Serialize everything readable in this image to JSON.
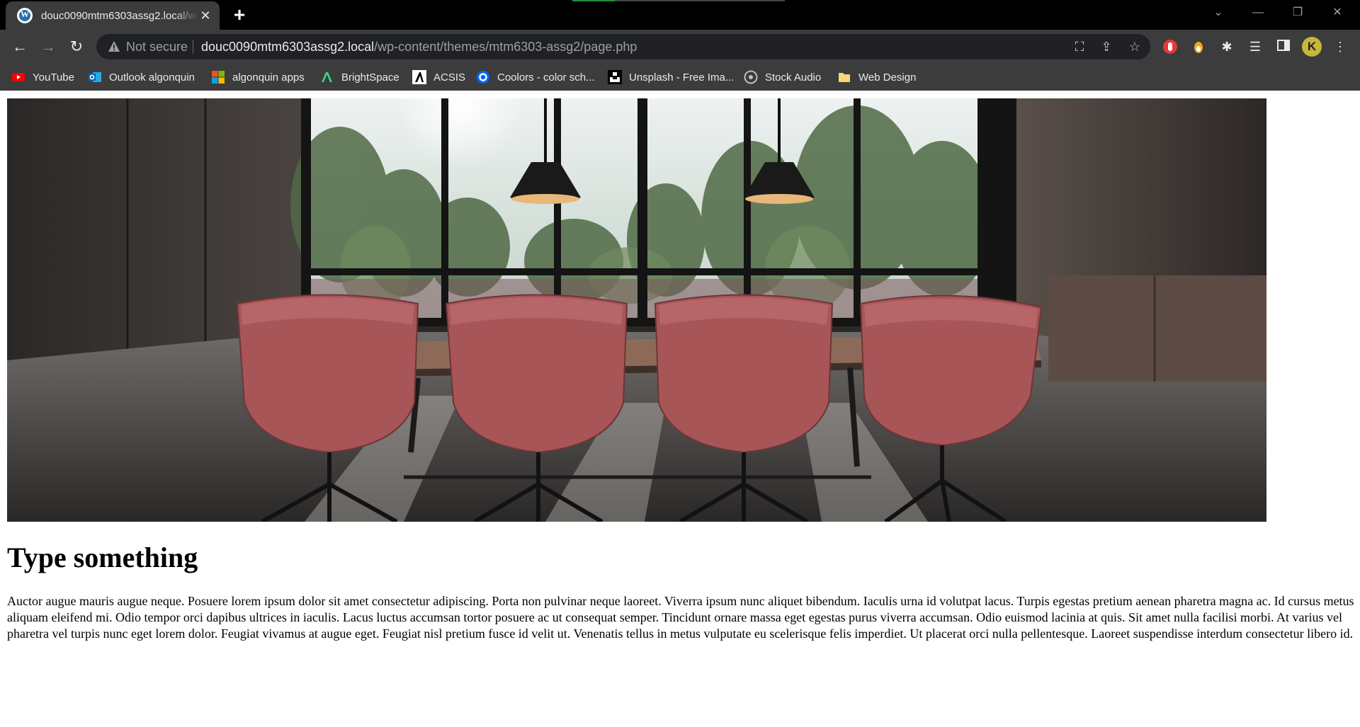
{
  "browser": {
    "tab": {
      "title": "douc0090mtm6303assg2.local/wp-content/themes/mtm6303-assg2/page.php",
      "close": "✕"
    },
    "new_tab": "+",
    "address": {
      "security_label": "Not secure",
      "host": "douc0090mtm6303assg2.local",
      "path": "/wp-content/themes/mtm6303-assg2/page.php"
    },
    "profile_initial": "K"
  },
  "bookmarks": [
    {
      "label": "YouTube",
      "icon": "youtube-icon"
    },
    {
      "label": "Outlook algonquin",
      "icon": "outlook-icon"
    },
    {
      "label": "algonquin apps",
      "icon": "microsoft-icon"
    },
    {
      "label": "BrightSpace",
      "icon": "brightspace-icon"
    },
    {
      "label": "ACSIS",
      "icon": "acsis-icon"
    },
    {
      "label": "Coolors - color sch...",
      "icon": "coolors-icon"
    },
    {
      "label": "Unsplash - Free Ima...",
      "icon": "unsplash-icon"
    },
    {
      "label": "Stock Audio",
      "icon": "audio-icon"
    },
    {
      "label": "Web Design",
      "icon": "folder-icon"
    }
  ],
  "page": {
    "heading": "Type something",
    "body": "Auctor augue mauris augue neque. Posuere lorem ipsum dolor sit amet consectetur adipiscing. Porta non pulvinar neque laoreet. Viverra ipsum nunc aliquet bibendum. Iaculis urna id volutpat lacus. Turpis egestas pretium aenean pharetra magna ac. Id cursus metus aliquam eleifend mi. Odio tempor orci dapibus ultrices in iaculis. Lacus luctus accumsan tortor posuere ac ut consequat semper. Tincidunt ornare massa eget egestas purus viverra accumsan. Odio euismod lacinia at quis. Sit amet nulla facilisi morbi. At varius vel pharetra vel turpis nunc eget lorem dolor. Feugiat vivamus at augue eget. Feugiat nisl pretium fusce id velit ut. Venenatis tellus in metus vulputate eu scelerisque felis imperdiet. Ut placerat orci nulla pellentesque. Laoreet suspendisse interdum consectetur libero id."
  },
  "colors": {
    "chrome_dark": "#000000",
    "toolbar": "#3c3c3c",
    "omnibox": "#202124",
    "chair_pink": "#b0595c"
  }
}
